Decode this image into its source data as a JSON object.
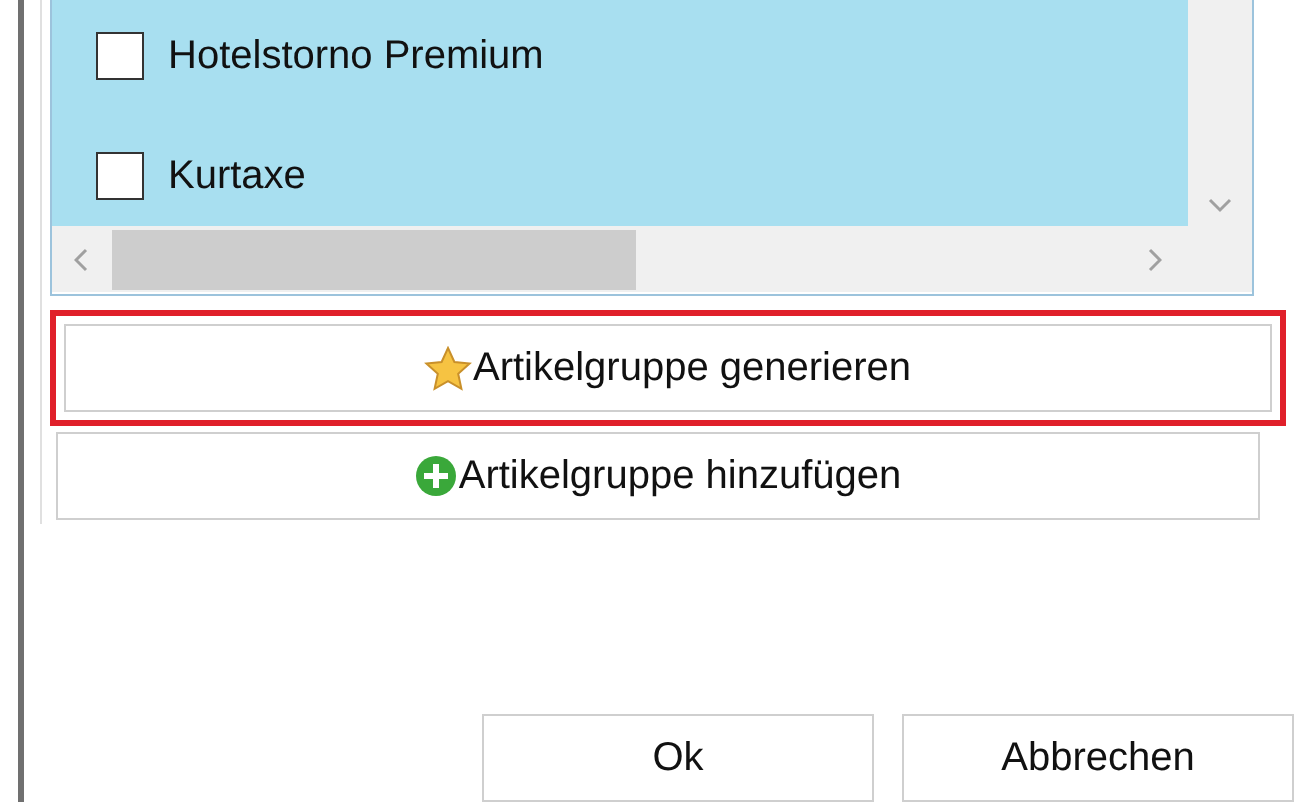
{
  "list": {
    "items": [
      {
        "label": "Hotelstorno Premium",
        "checked": false
      },
      {
        "label": "Kurtaxe",
        "checked": false
      }
    ]
  },
  "actions": [
    {
      "label": "Artikelgruppe generieren",
      "kind": "generate",
      "highlighted": true
    },
    {
      "label": "Artikelgruppe hinzufügen",
      "kind": "add",
      "highlighted": false
    }
  ],
  "buttons": [
    "Ok",
    "Abbrechen"
  ]
}
